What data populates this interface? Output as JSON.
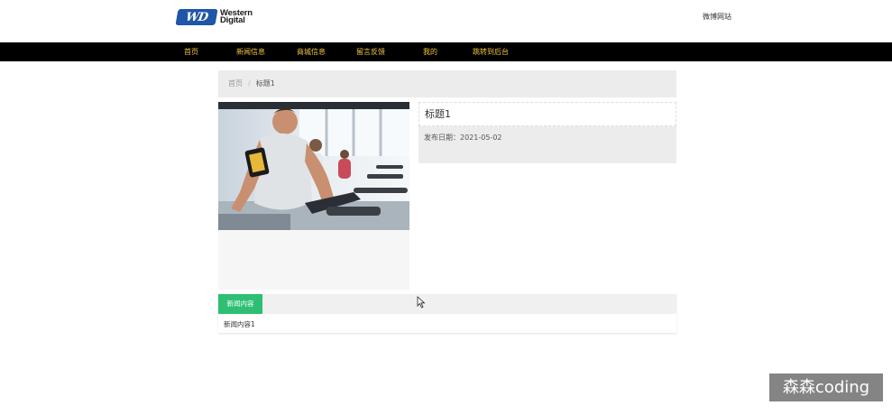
{
  "header": {
    "logo_mark": "WD",
    "logo_line1": "Western",
    "logo_line2": "Digital",
    "site_link": "微博网站"
  },
  "nav": {
    "items": [
      {
        "label": "首页"
      },
      {
        "label": "新闻信息"
      },
      {
        "label": "商城信息"
      },
      {
        "label": "留言反馈"
      },
      {
        "label": "我的"
      },
      {
        "label": "跳转到后台"
      }
    ]
  },
  "breadcrumb": {
    "home": "首页",
    "separator": "/",
    "current": "标题1"
  },
  "article": {
    "title": "标题1",
    "date_label": "发布日期：",
    "date_value": "2021-05-02",
    "image_icon": "fitness-photo"
  },
  "content": {
    "tab_label": "新闻内容",
    "body": "新闻内容1"
  },
  "watermark": "森森coding",
  "colors": {
    "nav_bg": "#000000",
    "nav_text": "#f4c542",
    "tab_active": "#2dbf74",
    "logo_blue": "#1f56a6"
  }
}
